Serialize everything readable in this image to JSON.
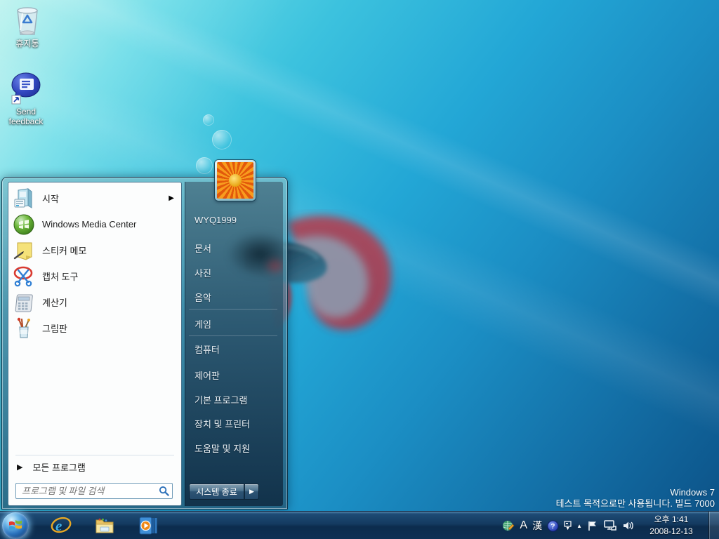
{
  "desktop": {
    "icons": [
      {
        "label": "휴지통"
      },
      {
        "label": "Send feedback"
      }
    ],
    "watermark": {
      "line1": "Windows 7",
      "line2": "테스트 목적으로만 사용됩니다. 빌드 7000"
    }
  },
  "start_menu": {
    "user_name": "WYQ1999",
    "left_items": [
      {
        "label": "시작"
      },
      {
        "label": "Windows Media Center"
      },
      {
        "label": "스티커 메모"
      },
      {
        "label": "캡처 도구"
      },
      {
        "label": "계산기"
      },
      {
        "label": "그림판"
      }
    ],
    "submenu_arrow": "▶",
    "all_programs_label": "모든 프로그램",
    "all_programs_arrow": "▶",
    "search_placeholder": "프로그램 및 파일 검색",
    "right_items": [
      "문서",
      "사진",
      "음악",
      "게임",
      "컴퓨터",
      "제어판",
      "기본 프로그램",
      "장치 및 프린터",
      "도움말 및 지원"
    ],
    "shutdown_label": "시스템 종료",
    "shutdown_arrow": "▶"
  },
  "taskbar": {
    "tray": {
      "ime_latin": "A",
      "ime_hanja": "漢",
      "help_mark": "?",
      "hidden_icons_arrow": "▲",
      "time": "오후 1:41",
      "date": "2008-12-13"
    }
  },
  "colors": {
    "taskbar_top": "#1d4a74",
    "taskbar_bottom": "#0e3054",
    "wallpaper_light": "#aaf0ea",
    "wallpaper_deep": "#0c4f82"
  }
}
